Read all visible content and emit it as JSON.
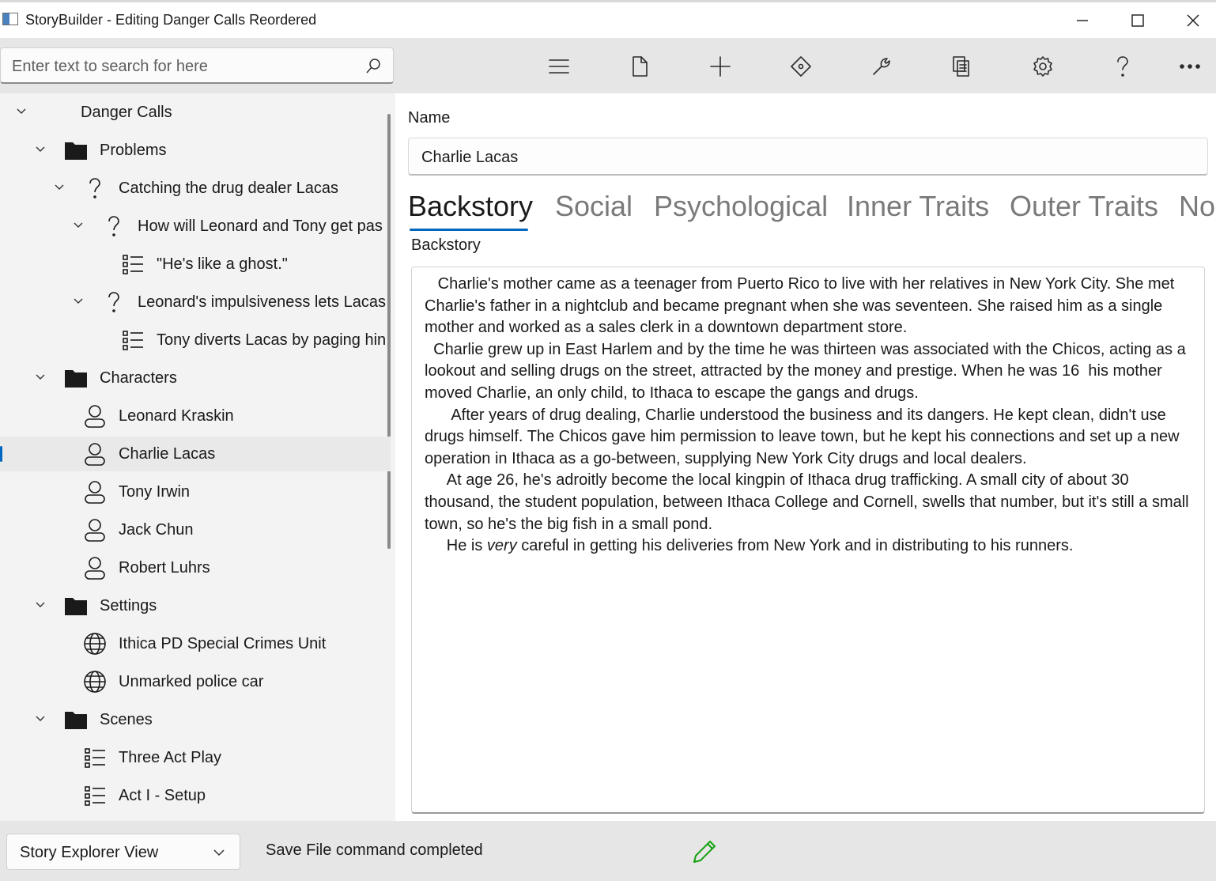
{
  "window": {
    "title": "StoryBuilder - Editing Danger Calls Reordered"
  },
  "search": {
    "placeholder": "Enter text to search for here"
  },
  "toolbar": {
    "icons": [
      "menu-icon",
      "new-file-icon",
      "add-icon",
      "move-icon",
      "tools-icon",
      "reports-icon",
      "settings-icon",
      "help-icon",
      "more-icon"
    ]
  },
  "tree": {
    "root": "Danger Calls",
    "problems": "Problems",
    "problem_1": "Catching the drug dealer Lacas",
    "problem_1_1": "How will Leonard and Tony get pas",
    "scene_1_1_1": "\"He's like a ghost.\"",
    "problem_1_2": "Leonard's impulsiveness lets Lacas",
    "scene_1_2_1": "Tony diverts Lacas by paging hin",
    "characters": "Characters",
    "char_1": "Leonard Kraskin",
    "char_2": "Charlie Lacas",
    "char_3": "Tony Irwin",
    "char_4": "Jack Chun",
    "char_5": "Robert Luhrs",
    "settings": "Settings",
    "setting_1": "Ithica PD Special Crimes Unit",
    "setting_2": "Unmarked police car",
    "scenes": "Scenes",
    "scene_1": "Three Act Play",
    "scene_2": "Act I - Setup"
  },
  "editor": {
    "name_label": "Name",
    "name_value": "Charlie Lacas",
    "tabs": [
      "Backstory",
      "Social",
      "Psychological",
      "Inner Traits",
      "Outer Traits",
      "No"
    ],
    "section_label": "Backstory",
    "backstory": {
      "p1": "   Charlie's mother came as a teenager from Puerto Rico to live with her relatives in New York City. She met Charlie's father in a nightclub and became pregnant when she was seventeen. She raised him as a single mother and worked as a sales clerk in a downtown department store.",
      "p2": "  Charlie grew up in East Harlem and by the time he was thirteen was associated with the Chicos, acting as a lookout and selling drugs on the street, attracted by the money and prestige. When he was 16  his mother moved Charlie, an only child, to Ithaca to escape the gangs and drugs.",
      "p3": "      After years of drug dealing, Charlie understood the business and its dangers. He kept clean, didn't use drugs himself. The Chicos gave him permission to leave town, but he kept his connections and set up a new operation in Ithaca as a go-between, supplying New York City drugs and local dealers.",
      "p4": "     At age 26, he's adroitly become the local kingpin of Ithaca drug trafficking. A small city of about 30 thousand, the student population, between Ithaca College and Cornell, swells that number, but it's still a small town, so he's the big fish in a small pond.",
      "p5_start": "     He is ",
      "p5_em": "very",
      "p5_end": " careful in getting his deliveries from New York and in distributing to his runners."
    }
  },
  "status": {
    "view_selected": "Story Explorer View",
    "message": "Save File command completed",
    "edit_color": "#13a10e"
  },
  "colors": {
    "accent": "#0067c0"
  }
}
